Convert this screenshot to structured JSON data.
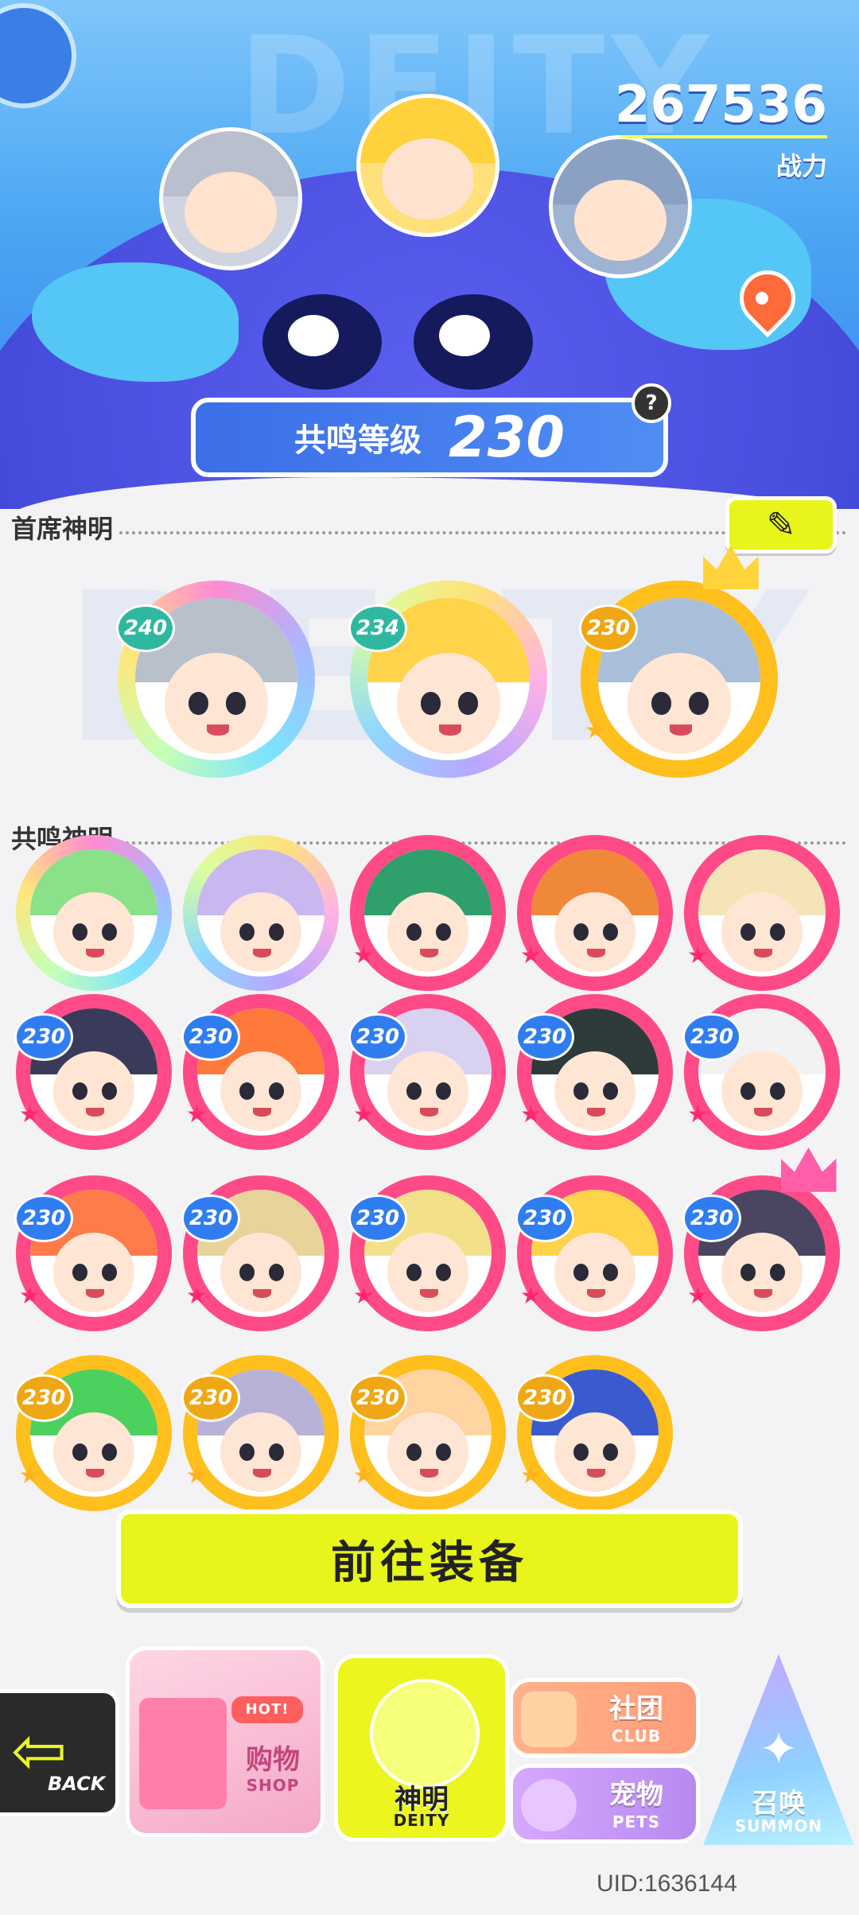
{
  "header": {
    "watermark": "DEITY",
    "combat_power_value": "267536",
    "combat_power_label": "战力",
    "resonance_label": "共鸣等级",
    "resonance_level": "230",
    "help_icon": "?"
  },
  "chief_section": {
    "title": "首席神明",
    "edit_icon": "pencil-icon",
    "watermark": "DEITY",
    "deities": [
      {
        "level": "240",
        "frame": "holo"
      },
      {
        "level": "234",
        "frame": "holo2"
      },
      {
        "level": "230",
        "frame": "gold",
        "crown": true
      }
    ]
  },
  "resonance_section": {
    "title": "共鸣神明",
    "rows": [
      [
        {
          "level": "",
          "frame": "holo"
        },
        {
          "level": "",
          "frame": "holo2"
        },
        {
          "level": "",
          "frame": "pink"
        },
        {
          "level": "",
          "frame": "pink"
        },
        {
          "level": "",
          "frame": "pink"
        }
      ],
      [
        {
          "level": "230",
          "frame": "pink"
        },
        {
          "level": "230",
          "frame": "pink"
        },
        {
          "level": "230",
          "frame": "pink"
        },
        {
          "level": "230",
          "frame": "pink"
        },
        {
          "level": "230",
          "frame": "pink"
        }
      ],
      [
        {
          "level": "230",
          "frame": "pink"
        },
        {
          "level": "230",
          "frame": "pink"
        },
        {
          "level": "230",
          "frame": "pink"
        },
        {
          "level": "230",
          "frame": "pink"
        },
        {
          "level": "230",
          "frame": "pink",
          "crown": true
        }
      ],
      [
        {
          "level": "230",
          "frame": "gold"
        },
        {
          "level": "230",
          "frame": "gold"
        },
        {
          "level": "230",
          "frame": "gold"
        },
        {
          "level": "230",
          "frame": "gold"
        }
      ]
    ]
  },
  "equip_button": "前往装备",
  "nav": {
    "back_label": "BACK",
    "shop_label": "购物",
    "shop_sub": "SHOP",
    "shop_badge": "HOT!",
    "deity_label": "神明",
    "deity_sub": "DEITY",
    "club_label": "社团",
    "club_sub": "CLUB",
    "pets_label": "宠物",
    "pets_sub": "PETS",
    "summon_label": "召唤",
    "summon_sub": "SUMMON"
  },
  "uid_text": "UID:1636144",
  "colors": {
    "accent_yellow": "#e7f51a",
    "frame_pink": "#ff4a88",
    "frame_gold": "#ffbf1c",
    "header_blue": "#4aa6f3"
  }
}
